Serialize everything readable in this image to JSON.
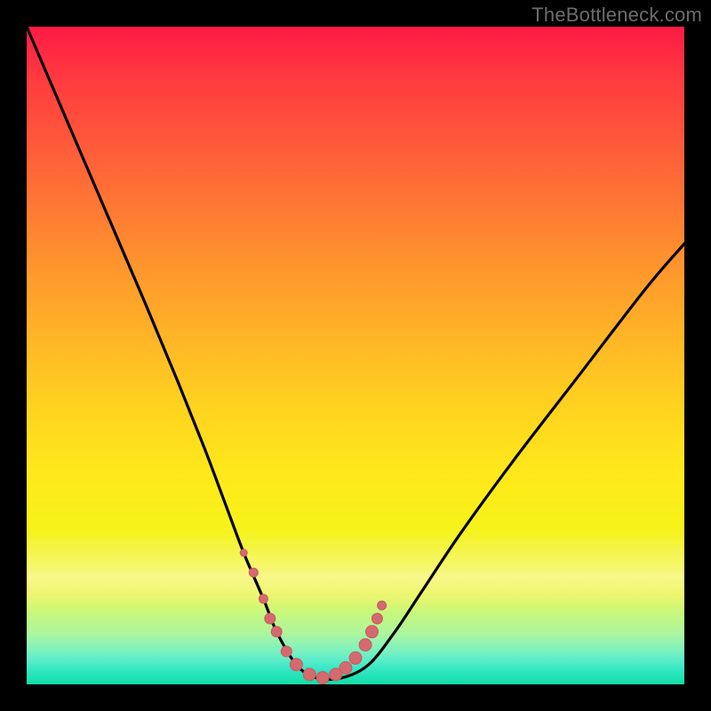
{
  "watermark": {
    "text": "TheBottleneck.com"
  },
  "colors": {
    "background": "#000000",
    "curve_stroke": "#000000",
    "marker_fill": "#d46a6f",
    "marker_stroke": "#c85a60",
    "gradient_top": "#ff1a45",
    "gradient_bottom": "#12dea6"
  },
  "chart_data": {
    "type": "line",
    "title": "",
    "xlabel": "",
    "ylabel": "",
    "xlim": [
      0,
      100
    ],
    "ylim": [
      0,
      100
    ],
    "grid": false,
    "legend": false,
    "series": [
      {
        "name": "bottleneck-curve",
        "x": [
          0,
          6,
          12,
          18,
          23,
          27,
          30,
          33,
          36,
          38,
          41,
          44,
          48,
          52,
          56,
          60,
          66,
          74,
          84,
          94,
          100
        ],
        "values": [
          100,
          86,
          72,
          58,
          46,
          36,
          28,
          20,
          13,
          8,
          3,
          1,
          1,
          3,
          8,
          14,
          23,
          34,
          47,
          60,
          67
        ]
      }
    ],
    "markers": {
      "x": [
        33.0,
        34.5,
        36.0,
        37.0,
        38.0,
        39.5,
        41.0,
        43.0,
        45.0,
        47.0,
        48.5,
        50.0,
        51.5,
        52.5,
        53.3,
        54.0
      ],
      "values": [
        20,
        17,
        13,
        10,
        8,
        5,
        3,
        1.5,
        1,
        1.5,
        2.5,
        4,
        6,
        8,
        10,
        12
      ],
      "radius": [
        4,
        5,
        5,
        6,
        6,
        6,
        7,
        7,
        7,
        7,
        7,
        7,
        7,
        7,
        6,
        5
      ]
    },
    "annotations": []
  }
}
